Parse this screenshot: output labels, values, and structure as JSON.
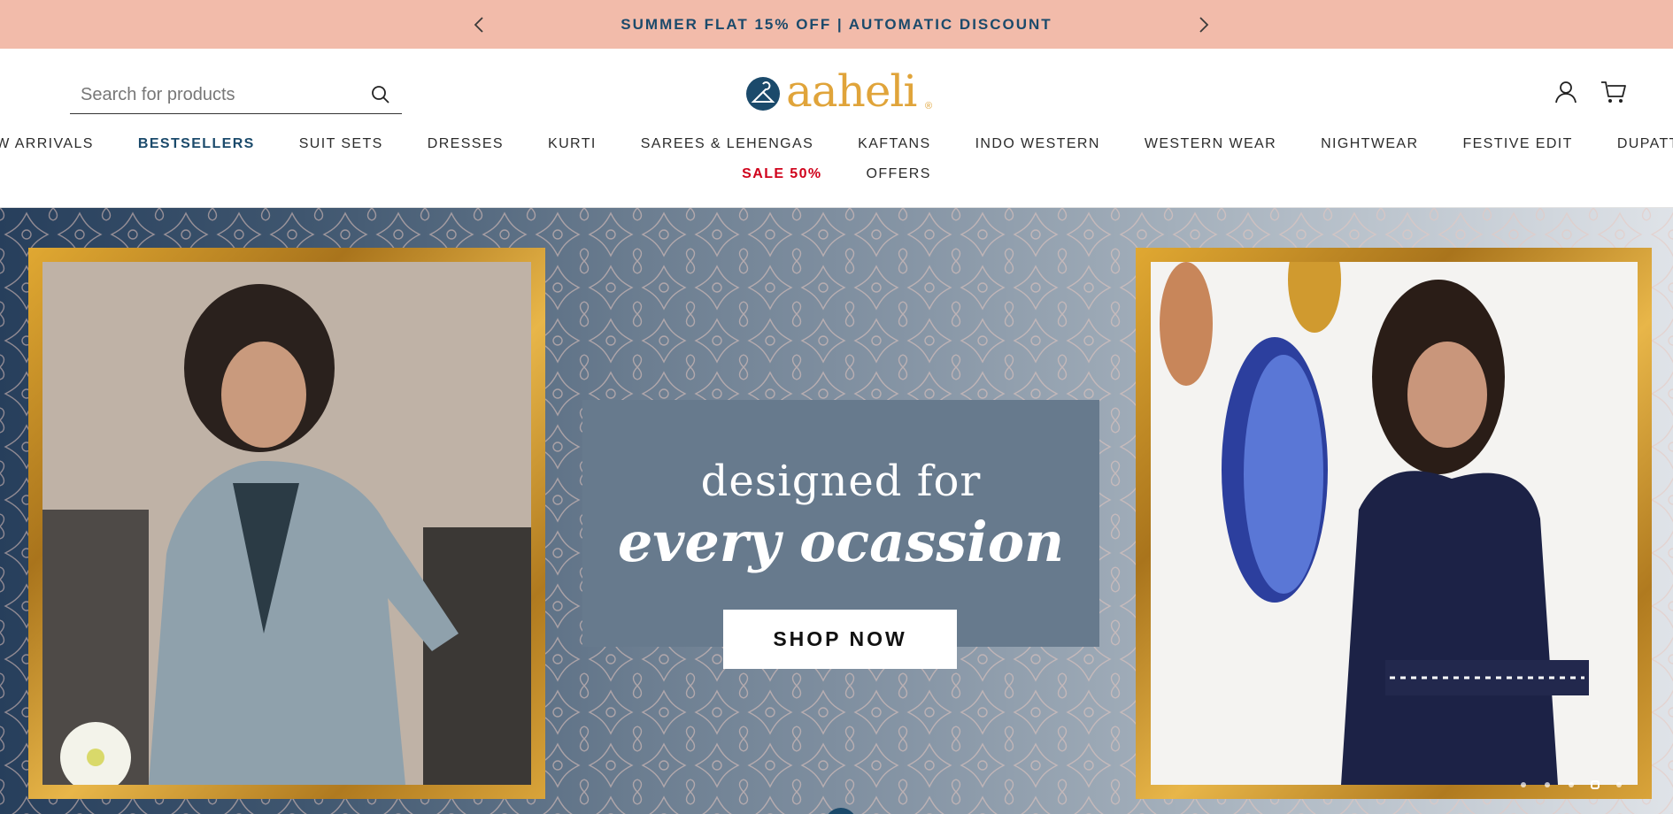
{
  "announcement": {
    "text": "SUMMER FLAT 15% OFF | AUTOMATIC DISCOUNT",
    "prev_icon": "chevron-left-icon",
    "next_icon": "chevron-right-icon",
    "background": "#f2bbaa",
    "text_color": "#1b4a6b"
  },
  "header": {
    "search": {
      "placeholder": "Search for products",
      "value": "",
      "icon": "search-icon"
    },
    "logo": {
      "text": "aaheli",
      "reg": "®",
      "color": "#e0a43a",
      "mark_color": "#1b4a6b"
    },
    "account_icon": "user-icon",
    "cart_icon": "cart-icon"
  },
  "nav": {
    "row1": [
      {
        "label": "NEW ARRIVALS"
      },
      {
        "label": "BESTSELLERS"
      },
      {
        "label": "SUIT SETS"
      },
      {
        "label": "DRESSES"
      },
      {
        "label": "KURTI"
      },
      {
        "label": "SAREES & LEHENGAS"
      },
      {
        "label": "KAFTANS"
      },
      {
        "label": "INDO WESTERN"
      },
      {
        "label": "WESTERN WEAR"
      },
      {
        "label": "NIGHTWEAR"
      },
      {
        "label": "FESTIVE EDIT"
      },
      {
        "label": "DUPATTAS"
      }
    ],
    "row2": [
      {
        "label": "SALE 50%"
      },
      {
        "label": "OFFERS"
      }
    ]
  },
  "hero": {
    "headline_line1": "designed for",
    "headline_line2": "every ocassion",
    "cta": "SHOP NOW",
    "slides_total": 5,
    "active_slide": 5
  }
}
